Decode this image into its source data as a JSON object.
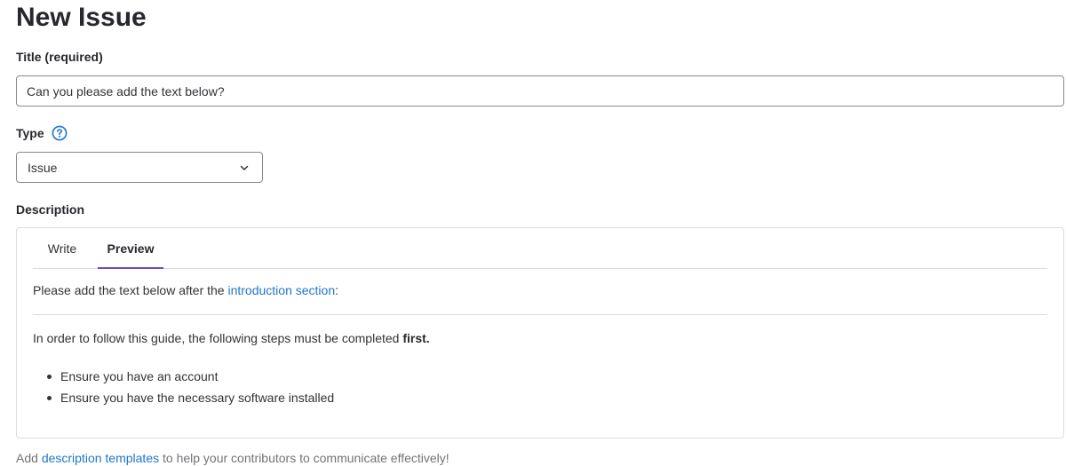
{
  "page": {
    "title": "New Issue"
  },
  "title_field": {
    "label": "Title (required)",
    "value": "Can you please add the text below?"
  },
  "type_field": {
    "label": "Type",
    "help_icon": "question-circle-icon",
    "selected": "Issue",
    "chevron_icon": "chevron-down-icon"
  },
  "description": {
    "label": "Description",
    "tabs": {
      "write": "Write",
      "preview": "Preview",
      "active": "Preview"
    },
    "preview": {
      "intro_before": "Please add the text below after the ",
      "intro_link": "introduction section",
      "intro_after": ":",
      "para_before": "In order to follow this guide, the following steps must be completed ",
      "para_bold": "first.",
      "bullets": [
        "Ensure you have an account",
        "Ensure you have the necessary software installed"
      ]
    }
  },
  "footer": {
    "before": "Add ",
    "link": "description templates",
    "after": " to help your contributors to communicate effectively!"
  },
  "colors": {
    "link": "#1f75cb",
    "active_tab_underline": "#6e49cb",
    "help_icon": "#1f75cb"
  }
}
